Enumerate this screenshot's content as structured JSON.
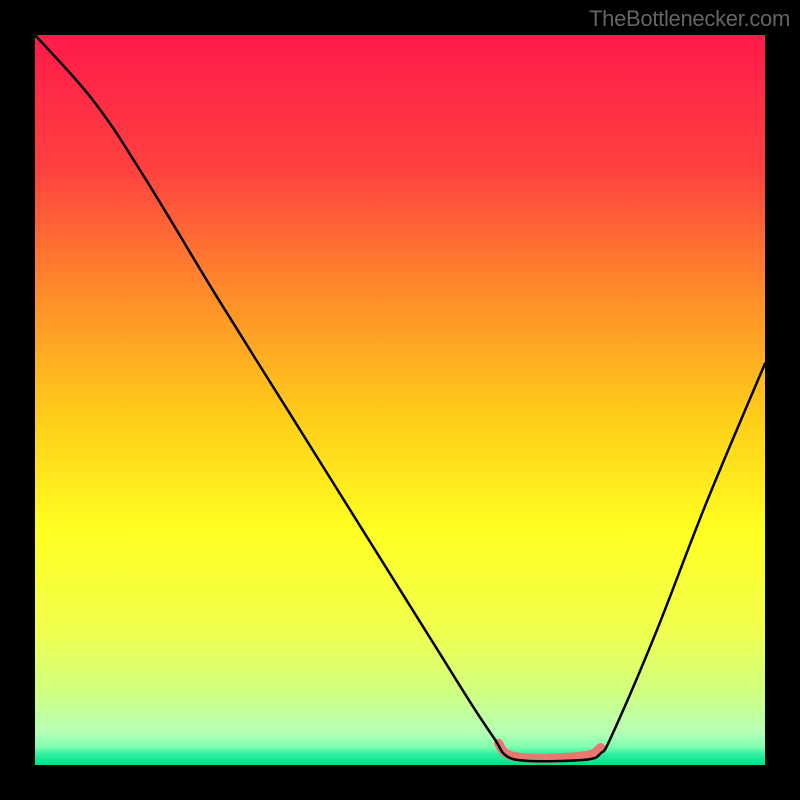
{
  "watermark": "TheBottlenecker.com",
  "chart_data": {
    "type": "line",
    "title": "",
    "xlabel": "",
    "ylabel": "",
    "xlim": [
      0,
      100
    ],
    "ylim": [
      0,
      100
    ],
    "gradient_stops": [
      {
        "offset": 0,
        "color": "#ff1a4a"
      },
      {
        "offset": 0.18,
        "color": "#ff4040"
      },
      {
        "offset": 0.35,
        "color": "#ff8a2b"
      },
      {
        "offset": 0.52,
        "color": "#ffcc1a"
      },
      {
        "offset": 0.68,
        "color": "#ffff20"
      },
      {
        "offset": 0.82,
        "color": "#f0ff50"
      },
      {
        "offset": 0.9,
        "color": "#d0ff80"
      },
      {
        "offset": 0.955,
        "color": "#b5ffb5"
      },
      {
        "offset": 0.975,
        "color": "#80ffb0"
      },
      {
        "offset": 0.985,
        "color": "#30f0a0"
      },
      {
        "offset": 1.0,
        "color": "#00e088"
      }
    ],
    "series": [
      {
        "name": "bottleneck-curve",
        "color": "#000000",
        "points": [
          {
            "x": 0,
            "y": 100
          },
          {
            "x": 8,
            "y": 91
          },
          {
            "x": 15,
            "y": 80.5
          },
          {
            "x": 25,
            "y": 64
          },
          {
            "x": 35,
            "y": 48
          },
          {
            "x": 45,
            "y": 32
          },
          {
            "x": 55,
            "y": 16
          },
          {
            "x": 60,
            "y": 8
          },
          {
            "x": 63,
            "y": 3.5
          },
          {
            "x": 64.5,
            "y": 1.3
          },
          {
            "x": 67,
            "y": 0.6
          },
          {
            "x": 72,
            "y": 0.55
          },
          {
            "x": 76,
            "y": 0.8
          },
          {
            "x": 77.5,
            "y": 1.6
          },
          {
            "x": 79,
            "y": 4
          },
          {
            "x": 85,
            "y": 18
          },
          {
            "x": 92,
            "y": 36
          },
          {
            "x": 100,
            "y": 55
          }
        ]
      },
      {
        "name": "highlight-segment",
        "color": "#e8776f",
        "stroke_width": 9,
        "points": [
          {
            "x": 63.5,
            "y": 3.0
          },
          {
            "x": 64.5,
            "y": 1.6
          },
          {
            "x": 67,
            "y": 1.0
          },
          {
            "x": 72,
            "y": 1.0
          },
          {
            "x": 76,
            "y": 1.4
          },
          {
            "x": 77.5,
            "y": 2.4
          }
        ]
      }
    ]
  }
}
